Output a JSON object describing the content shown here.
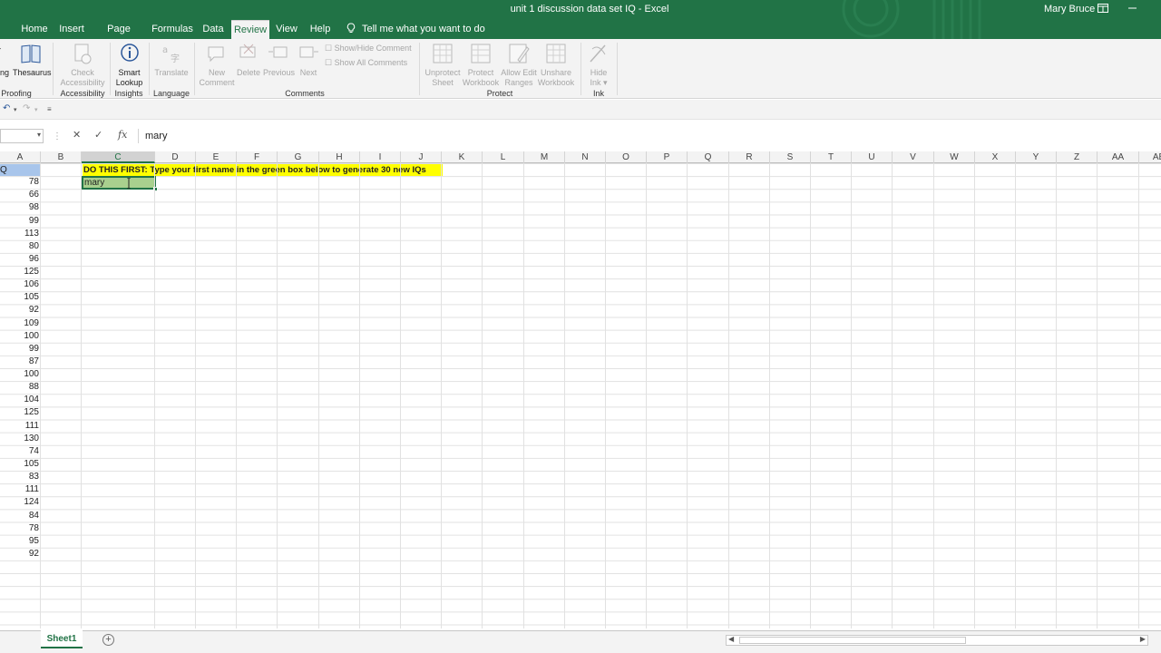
{
  "window": {
    "title": "unit 1 discussion data set IQ  -  Excel",
    "user": "Mary Bruce"
  },
  "tabs": [
    {
      "label": "Home"
    },
    {
      "label": "Insert"
    },
    {
      "label": "Page Layout"
    },
    {
      "label": "Formulas"
    },
    {
      "label": "Data"
    },
    {
      "label": "Review",
      "active": true
    },
    {
      "label": "View"
    },
    {
      "label": "Help"
    }
  ],
  "tell_me": "Tell me what you want to do",
  "ribbon": {
    "proofing": {
      "partial_label": "ing",
      "thesaurus": "Thesaurus",
      "group": "Proofing"
    },
    "accessibility": {
      "check_line1": "Check",
      "check_line2": "Accessibility",
      "group": "Accessibility"
    },
    "insights": {
      "smart_line1": "Smart",
      "smart_line2": "Lookup",
      "group": "Insights"
    },
    "language": {
      "translate": "Translate",
      "group": "Language"
    },
    "comments": {
      "new_line1": "New",
      "new_line2": "Comment",
      "delete": "Delete",
      "previous": "Previous",
      "next": "Next",
      "show_hide": "Show/Hide Comment",
      "show_all": "Show All Comments",
      "group": "Comments"
    },
    "protect": {
      "unprotect_line1": "Unprotect",
      "unprotect_line2": "Sheet",
      "protect_wb_line1": "Protect",
      "protect_wb_line2": "Workbook",
      "allow_line1": "Allow Edit",
      "allow_line2": "Ranges",
      "unshare_line1": "Unshare",
      "unshare_line2": "Workbook",
      "group": "Protect"
    },
    "ink": {
      "hide_line1": "Hide",
      "hide_line2": "Ink",
      "group": "Ink"
    }
  },
  "formula_bar": {
    "name_box": "",
    "value": "mary",
    "fx": "fx"
  },
  "columns": [
    "A",
    "B",
    "C",
    "D",
    "E",
    "F",
    "G",
    "H",
    "I",
    "J",
    "K",
    "L",
    "M",
    "N",
    "O",
    "P",
    "Q",
    "R",
    "S",
    "T",
    "U",
    "V",
    "W",
    "X",
    "Y",
    "Z",
    "AA",
    "AB"
  ],
  "selected_column": "C",
  "sheet": {
    "a1_partial": "Q",
    "banner": "DO THIS FIRST: Type your first name in the green box below to generate 30 new IQs",
    "name_cell": "mary",
    "iq_values": [
      78,
      66,
      98,
      99,
      113,
      80,
      96,
      125,
      106,
      105,
      92,
      109,
      100,
      99,
      87,
      100,
      88,
      104,
      125,
      111,
      130,
      74,
      105,
      83,
      111,
      124,
      84,
      78,
      95,
      92
    ]
  },
  "sheet_tabs": [
    {
      "label": "Sheet1",
      "active": true
    }
  ],
  "colors": {
    "excel_green": "#217346",
    "banner_yellow": "#ffff00",
    "name_cell_green": "#a9d08e"
  }
}
